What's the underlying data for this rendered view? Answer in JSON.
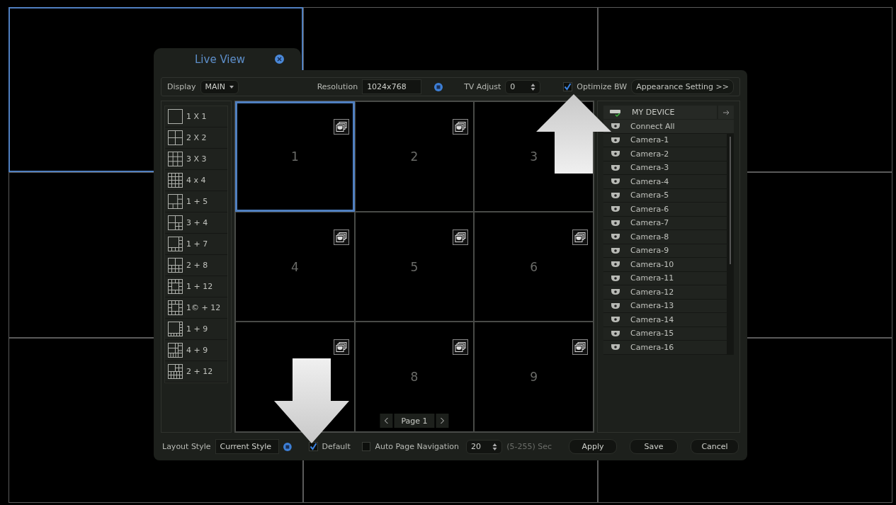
{
  "background_tiles": [
    {
      "selected": true
    },
    {
      "selected": false
    },
    {
      "selected": false
    },
    {
      "selected": false
    },
    {
      "selected": false
    },
    {
      "selected": false
    },
    {
      "selected": false
    },
    {
      "selected": false
    }
  ],
  "window": {
    "title": "Live View"
  },
  "toolbar": {
    "display_label": "Display",
    "display_value": "MAIN",
    "resolution_label": "Resolution",
    "resolution_value": "1024x768",
    "tv_adjust_label": "TV Adjust",
    "tv_adjust_value": "0",
    "optimize_bw": {
      "label": "Optimize BW",
      "checked": true
    },
    "appearance_button": "Appearance Setting >>"
  },
  "layouts": [
    {
      "kind": "l1",
      "label": "1 X 1"
    },
    {
      "kind": "l4",
      "label": "2 X 2"
    },
    {
      "kind": "l9",
      "label": "3 X 3"
    },
    {
      "kind": "l16",
      "label": "4 x 4"
    },
    {
      "kind": "l6",
      "label": "1 + 5"
    },
    {
      "kind": "l7",
      "label": "3 + 4"
    },
    {
      "kind": "l8",
      "label": "1 + 7"
    },
    {
      "kind": "l10",
      "label": "2 + 8"
    },
    {
      "kind": "l13",
      "label": "1 + 12"
    },
    {
      "kind": "l13c",
      "label": "1© + 12"
    },
    {
      "kind": "l10b",
      "label": "1 + 9"
    },
    {
      "kind": "l13b",
      "label": "4 + 9"
    },
    {
      "kind": "l14",
      "label": "2 + 12"
    }
  ],
  "cells": [
    {
      "label": "1",
      "selected": true
    },
    {
      "label": "2",
      "selected": false
    },
    {
      "label": "3",
      "selected": false
    },
    {
      "label": "4",
      "selected": false
    },
    {
      "label": "5",
      "selected": false
    },
    {
      "label": "6",
      "selected": false
    },
    {
      "selected": false
    },
    {
      "label": "8",
      "selected": false
    },
    {
      "label": "9",
      "selected": false
    }
  ],
  "pager": {
    "label": "Page 1"
  },
  "device_panel": {
    "title": "MY DEVICE",
    "connect_all": "Connect All",
    "cameras": [
      "Camera-1",
      "Camera-2",
      "Camera-3",
      "Camera-4",
      "Camera-5",
      "Camera-6",
      "Camera-7",
      "Camera-8",
      "Camera-9",
      "Camera-10",
      "Camera-11",
      "Camera-12",
      "Camera-13",
      "Camera-14",
      "Camera-15",
      "Camera-16"
    ]
  },
  "footer": {
    "layout_style_label": "Layout Style",
    "layout_style_value": "Current Style",
    "default": {
      "label": "Default",
      "checked": true
    },
    "auto_page": {
      "label": "Auto Page Navigation",
      "checked": false
    },
    "interval_value": "20",
    "interval_hint": "(5-255) Sec",
    "buttons": [
      "Apply",
      "Save",
      "Cancel"
    ]
  }
}
